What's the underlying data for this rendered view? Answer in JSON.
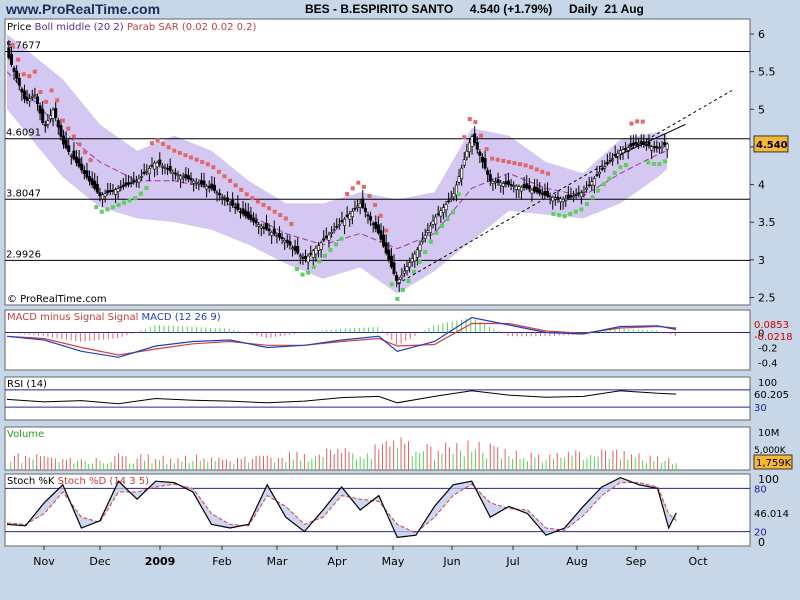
{
  "header": {
    "site": "www.ProRealTime.com",
    "title": "BES - B.ESPIRITO SANTO     4.540 (+1.79%)     Daily  21 Aug"
  },
  "colors": {
    "background": "#c7d7e8",
    "panel": "#ffffff",
    "bollinger_band": "#d4c8f2",
    "sar_down": "#e06868",
    "sar_up": "#5ccf5c",
    "boll_middle": "#9c3aa0",
    "macd_line": "#2040c0",
    "signal_line": "#d04040",
    "volume_bar": "#e06060",
    "stoch_k": "#000000",
    "stoch_d": "#d04040",
    "level_line": "#2020a0"
  },
  "chart_data": [
    {
      "type": "candlestick",
      "title": "Price",
      "legend": [
        "Price",
        "Boll middle (20 2)",
        "Parab SAR (0.02 0.02 0.2)"
      ],
      "months": [
        "Nov",
        "Dec",
        "2009",
        "Feb",
        "Mar",
        "Apr",
        "May",
        "Jun",
        "Jul",
        "Aug",
        "Sep",
        "Oct"
      ],
      "ylim": [
        2.4,
        6.2
      ],
      "y_ticks": [
        "6",
        "5.5",
        "5",
        "4.5",
        "4",
        "3.5",
        "3",
        "2.5"
      ],
      "levels": [
        {
          "label": "5.7677",
          "value": 5.7677
        },
        {
          "label": "4.6091",
          "value": 4.6091
        },
        {
          "label": "3.8047",
          "value": 3.8047
        },
        {
          "label": "2.9926",
          "value": 2.9926
        }
      ],
      "last_value_label": "4.540",
      "last_value": 4.54,
      "price_path": [
        [
          0,
          5.75
        ],
        [
          1,
          5.1
        ],
        [
          1.5,
          5.2
        ],
        [
          2,
          4.75
        ],
        [
          2.5,
          5.0
        ],
        [
          3,
          4.55
        ],
        [
          4,
          4.2
        ],
        [
          5,
          3.85
        ],
        [
          6,
          3.95
        ],
        [
          7,
          4.05
        ],
        [
          8,
          4.3
        ],
        [
          9,
          4.15
        ],
        [
          10,
          4.05
        ],
        [
          11,
          3.95
        ],
        [
          12,
          3.75
        ],
        [
          13,
          3.55
        ],
        [
          14,
          3.4
        ],
        [
          15,
          3.25
        ],
        [
          16,
          3.0
        ],
        [
          17,
          3.25
        ],
        [
          18,
          3.5
        ],
        [
          19,
          3.75
        ],
        [
          20,
          3.35
        ],
        [
          21,
          2.7
        ],
        [
          22,
          3.1
        ],
        [
          23,
          3.55
        ],
        [
          24,
          3.85
        ],
        [
          25,
          4.65
        ],
        [
          26,
          4.05
        ],
        [
          27,
          4.0
        ],
        [
          28,
          3.95
        ],
        [
          29,
          3.85
        ],
        [
          30,
          3.8
        ],
        [
          31,
          3.9
        ],
        [
          32,
          4.2
        ],
        [
          33,
          4.45
        ],
        [
          34,
          4.55
        ],
        [
          35,
          4.48
        ],
        [
          35.5,
          4.54
        ]
      ],
      "boll_middle_path": [
        [
          0,
          5.5
        ],
        [
          3,
          4.7
        ],
        [
          5,
          4.3
        ],
        [
          7,
          4.05
        ],
        [
          9,
          4.05
        ],
        [
          11,
          3.95
        ],
        [
          13,
          3.6
        ],
        [
          15,
          3.35
        ],
        [
          17,
          3.2
        ],
        [
          19,
          3.35
        ],
        [
          21,
          3.15
        ],
        [
          23,
          3.35
        ],
        [
          25,
          3.95
        ],
        [
          27,
          4.15
        ],
        [
          29,
          3.95
        ],
        [
          31,
          3.85
        ],
        [
          33,
          4.15
        ],
        [
          35,
          4.4
        ],
        [
          35.5,
          4.45
        ]
      ],
      "boll_upper_path": [
        [
          0,
          6.0
        ],
        [
          3,
          5.4
        ],
        [
          5,
          4.8
        ],
        [
          7,
          4.45
        ],
        [
          9,
          4.65
        ],
        [
          11,
          4.45
        ],
        [
          13,
          4.05
        ],
        [
          15,
          3.75
        ],
        [
          17,
          3.75
        ],
        [
          19,
          3.9
        ],
        [
          21,
          3.8
        ],
        [
          23,
          3.9
        ],
        [
          25,
          4.75
        ],
        [
          27,
          4.65
        ],
        [
          29,
          4.3
        ],
        [
          31,
          4.15
        ],
        [
          33,
          4.6
        ],
        [
          35,
          4.7
        ],
        [
          35.5,
          4.68
        ]
      ],
      "boll_lower_path": [
        [
          0,
          5.0
        ],
        [
          3,
          4.1
        ],
        [
          5,
          3.7
        ],
        [
          7,
          3.55
        ],
        [
          9,
          3.5
        ],
        [
          11,
          3.4
        ],
        [
          13,
          3.2
        ],
        [
          15,
          2.95
        ],
        [
          17,
          2.75
        ],
        [
          19,
          2.9
        ],
        [
          21,
          2.55
        ],
        [
          23,
          2.85
        ],
        [
          25,
          3.25
        ],
        [
          27,
          3.65
        ],
        [
          29,
          3.6
        ],
        [
          31,
          3.55
        ],
        [
          33,
          3.75
        ],
        [
          35,
          4.1
        ],
        [
          35.5,
          4.2
        ]
      ],
      "trendlines": [
        {
          "style": "dashed",
          "from": [
            21,
            2.68
          ],
          "to": [
            39,
            5.25
          ]
        },
        {
          "style": "solid",
          "from": [
            33,
            4.4
          ],
          "to": [
            36.5,
            4.8
          ]
        }
      ]
    },
    {
      "type": "line",
      "title": "MACD minus Signal Signal MACD (12 26 9)",
      "ylim": [
        -0.5,
        0.3
      ],
      "y_ticks": [
        "0",
        "-0.2",
        "-0.4"
      ],
      "value_labels": [
        "0.0853",
        "-0.0218"
      ],
      "macd": [
        [
          0,
          -0.05
        ],
        [
          2,
          -0.1
        ],
        [
          4,
          -0.25
        ],
        [
          6,
          -0.33
        ],
        [
          8,
          -0.18
        ],
        [
          10,
          -0.12
        ],
        [
          12,
          -0.1
        ],
        [
          14,
          -0.2
        ],
        [
          16,
          -0.17
        ],
        [
          18,
          -0.1
        ],
        [
          20,
          -0.05
        ],
        [
          21,
          -0.25
        ],
        [
          23,
          -0.12
        ],
        [
          25,
          0.2
        ],
        [
          27,
          0.1
        ],
        [
          29,
          0.0
        ],
        [
          31,
          -0.02
        ],
        [
          33,
          0.08
        ],
        [
          35,
          0.09
        ],
        [
          36,
          0.04
        ]
      ],
      "signal": [
        [
          0,
          -0.05
        ],
        [
          2,
          -0.08
        ],
        [
          4,
          -0.2
        ],
        [
          6,
          -0.3
        ],
        [
          8,
          -0.22
        ],
        [
          10,
          -0.15
        ],
        [
          12,
          -0.12
        ],
        [
          14,
          -0.17
        ],
        [
          16,
          -0.17
        ],
        [
          18,
          -0.12
        ],
        [
          20,
          -0.08
        ],
        [
          21,
          -0.18
        ],
        [
          23,
          -0.16
        ],
        [
          25,
          0.12
        ],
        [
          27,
          0.12
        ],
        [
          29,
          0.02
        ],
        [
          31,
          -0.01
        ],
        [
          33,
          0.06
        ],
        [
          35,
          0.08
        ],
        [
          36,
          0.06
        ]
      ]
    },
    {
      "type": "line",
      "title": "RSI (14)",
      "ylim": [
        0,
        100
      ],
      "y_ticks": [
        "100"
      ],
      "value_labels": [
        "60.205",
        "30"
      ],
      "levels": [
        70,
        30
      ],
      "values": [
        [
          0,
          48
        ],
        [
          2,
          42
        ],
        [
          4,
          45
        ],
        [
          6,
          38
        ],
        [
          8,
          50
        ],
        [
          10,
          46
        ],
        [
          12,
          44
        ],
        [
          14,
          40
        ],
        [
          16,
          44
        ],
        [
          18,
          52
        ],
        [
          20,
          55
        ],
        [
          21,
          40
        ],
        [
          23,
          55
        ],
        [
          25,
          68
        ],
        [
          27,
          58
        ],
        [
          29,
          53
        ],
        [
          31,
          55
        ],
        [
          33,
          68
        ],
        [
          35,
          62
        ],
        [
          36,
          60.2
        ]
      ]
    },
    {
      "type": "bar",
      "title": "Volume",
      "ylim": [
        0,
        10
      ],
      "y_ticks": [
        "10M",
        "5,000K"
      ],
      "value_labels": [
        "1,759K"
      ],
      "values": [
        [
          0,
          3
        ],
        [
          2,
          2.5
        ],
        [
          4,
          2.2
        ],
        [
          6,
          2.8
        ],
        [
          8,
          2.5
        ],
        [
          10,
          2.6
        ],
        [
          12,
          2.0
        ],
        [
          14,
          2.4
        ],
        [
          16,
          3.2
        ],
        [
          18,
          3.6
        ],
        [
          20,
          4.5
        ],
        [
          21,
          5.8
        ],
        [
          23,
          4.0
        ],
        [
          25,
          5.5
        ],
        [
          27,
          3.2
        ],
        [
          29,
          2.8
        ],
        [
          31,
          3.8
        ],
        [
          33,
          3.5
        ],
        [
          35,
          2.5
        ],
        [
          36,
          1.8
        ]
      ]
    },
    {
      "type": "line",
      "title": "Stoch %K Stoch %D (14 3 5)",
      "ylim": [
        0,
        100
      ],
      "y_ticks": [
        "100",
        "0"
      ],
      "value_labels": [
        "80",
        "46.014",
        "20"
      ],
      "levels": [
        80,
        20
      ],
      "k": [
        [
          0,
          30
        ],
        [
          1,
          28
        ],
        [
          2,
          60
        ],
        [
          3,
          85
        ],
        [
          4,
          25
        ],
        [
          5,
          35
        ],
        [
          6,
          90
        ],
        [
          7,
          65
        ],
        [
          8,
          90
        ],
        [
          9,
          88
        ],
        [
          10,
          75
        ],
        [
          11,
          30
        ],
        [
          12,
          25
        ],
        [
          13,
          30
        ],
        [
          14,
          85
        ],
        [
          15,
          40
        ],
        [
          16,
          20
        ],
        [
          17,
          50
        ],
        [
          18,
          82
        ],
        [
          19,
          50
        ],
        [
          20,
          70
        ],
        [
          21,
          12
        ],
        [
          22,
          15
        ],
        [
          23,
          55
        ],
        [
          24,
          85
        ],
        [
          25,
          90
        ],
        [
          26,
          40
        ],
        [
          27,
          55
        ],
        [
          28,
          45
        ],
        [
          29,
          15
        ],
        [
          30,
          25
        ],
        [
          31,
          55
        ],
        [
          32,
          82
        ],
        [
          33,
          95
        ],
        [
          34,
          85
        ],
        [
          35,
          80
        ],
        [
          35.6,
          25
        ],
        [
          36,
          46
        ]
      ],
      "d": [
        [
          0,
          32
        ],
        [
          1,
          30
        ],
        [
          2,
          45
        ],
        [
          3,
          75
        ],
        [
          4,
          40
        ],
        [
          5,
          33
        ],
        [
          6,
          75
        ],
        [
          7,
          75
        ],
        [
          8,
          82
        ],
        [
          9,
          86
        ],
        [
          10,
          80
        ],
        [
          11,
          45
        ],
        [
          12,
          30
        ],
        [
          13,
          28
        ],
        [
          14,
          70
        ],
        [
          15,
          55
        ],
        [
          16,
          30
        ],
        [
          17,
          40
        ],
        [
          18,
          70
        ],
        [
          19,
          65
        ],
        [
          20,
          62
        ],
        [
          21,
          30
        ],
        [
          22,
          18
        ],
        [
          23,
          40
        ],
        [
          24,
          70
        ],
        [
          25,
          86
        ],
        [
          26,
          60
        ],
        [
          27,
          52
        ],
        [
          28,
          50
        ],
        [
          29,
          25
        ],
        [
          30,
          22
        ],
        [
          31,
          42
        ],
        [
          32,
          70
        ],
        [
          33,
          88
        ],
        [
          34,
          88
        ],
        [
          35,
          82
        ],
        [
          35.6,
          45
        ],
        [
          36,
          35
        ]
      ]
    }
  ],
  "footer": {
    "watermark": "© ProRealTime.com"
  }
}
